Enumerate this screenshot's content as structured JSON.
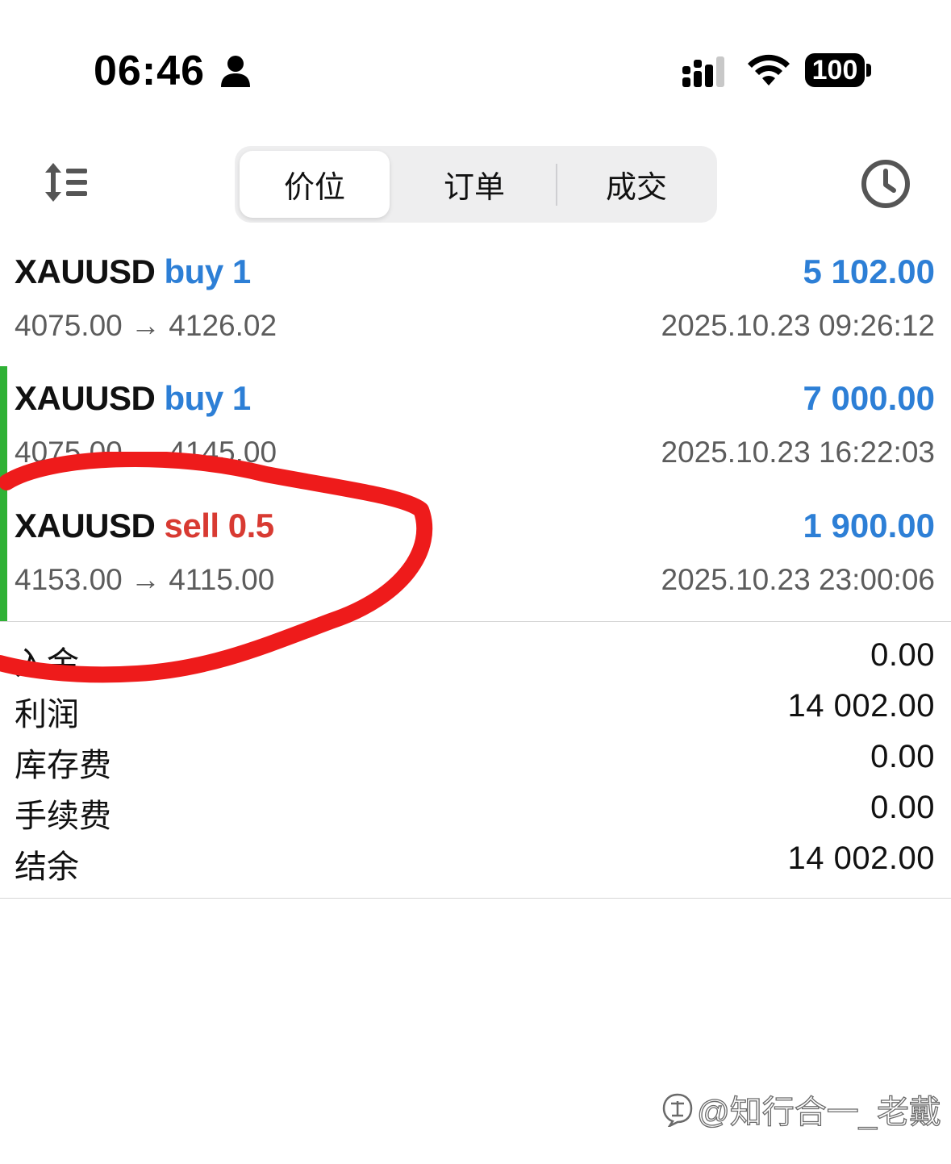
{
  "status_bar": {
    "time": "06:46",
    "battery": "100"
  },
  "toolbar": {
    "tabs": [
      {
        "label": "价位",
        "active": true
      },
      {
        "label": "订单",
        "active": false
      },
      {
        "label": "成交",
        "active": false
      }
    ]
  },
  "deals": [
    {
      "symbol": "XAUUSD",
      "side": "buy 1",
      "side_type": "buy",
      "profit": "5 102.00",
      "prices": "4075.00 → 4126.02",
      "time": "2025.10.23 09:26:12",
      "accent": false
    },
    {
      "symbol": "XAUUSD",
      "side": "buy 1",
      "side_type": "buy",
      "profit": "7 000.00",
      "prices": "4075.00 → 4145.00",
      "time": "2025.10.23 16:22:03",
      "accent": true
    },
    {
      "symbol": "XAUUSD",
      "side": "sell 0.5",
      "side_type": "sell",
      "profit": "1 900.00",
      "prices": "4153.00 → 4115.00",
      "time": "2025.10.23 23:00:06",
      "accent": true
    }
  ],
  "summary": [
    {
      "label": "入金",
      "value": "0.00"
    },
    {
      "label": "利润",
      "value": "14 002.00"
    },
    {
      "label": "库存费",
      "value": "0.00"
    },
    {
      "label": "手续费",
      "value": "0.00"
    },
    {
      "label": "结余",
      "value": "14 002.00"
    }
  ],
  "watermark": "@知行合一_老戴",
  "colors": {
    "buy": "#2d7fd6",
    "sell": "#d83a32",
    "profit": "#2d7fd6",
    "accent_bar": "#2fb135",
    "annotation": "#ee1b1b"
  },
  "icons": [
    "person-icon",
    "signal-icon",
    "wifi-icon",
    "battery-icon",
    "sort-icon",
    "clock-icon",
    "zhihu-logo-icon"
  ]
}
